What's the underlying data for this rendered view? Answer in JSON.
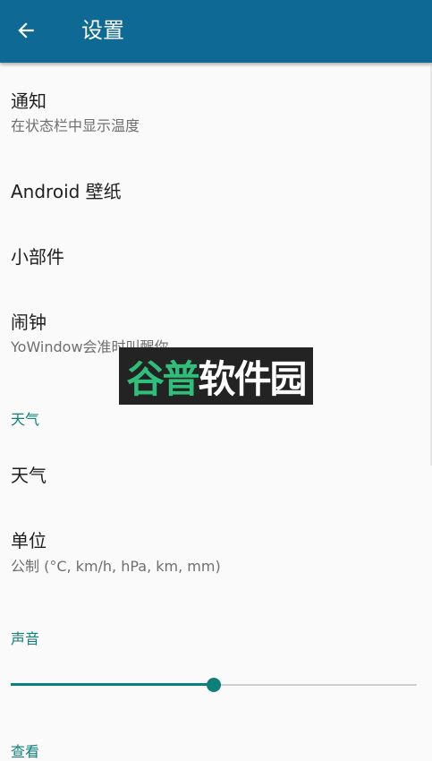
{
  "app_bar": {
    "title": "设置",
    "back_icon": "arrow-back-icon",
    "background": "#0e6994"
  },
  "preferences": [
    {
      "title": "通知",
      "summary": "在状态栏中显示温度"
    },
    {
      "title": "Android 壁纸",
      "summary": ""
    },
    {
      "title": "小部件",
      "summary": ""
    },
    {
      "title": "闹钟",
      "summary": "YoWindow会准时叫醒你"
    }
  ],
  "weather_section": {
    "header": "天气",
    "items": [
      {
        "title": "天气",
        "summary": ""
      },
      {
        "title": "单位",
        "summary": "公制 (°C, km/h, hPa, km, mm)"
      }
    ]
  },
  "sound_section": {
    "header": "声音",
    "volume_fraction": 0.5
  },
  "next_section": {
    "header": "查看"
  },
  "watermark": {
    "part1": "谷普",
    "part2": "软件园"
  },
  "colors": {
    "accent": "#0e7f7a",
    "primary": "#0e6994"
  }
}
